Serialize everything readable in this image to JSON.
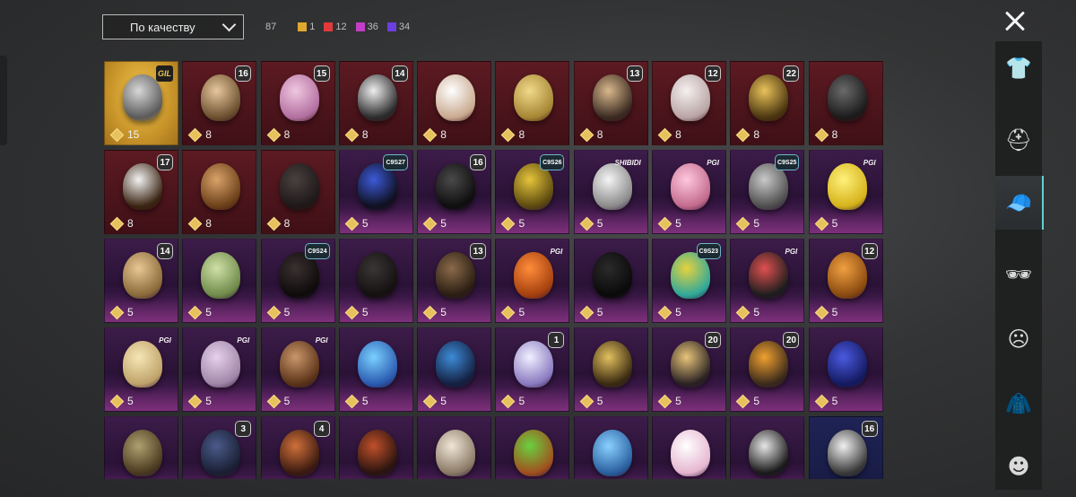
{
  "filter": {
    "selected": "По качеству"
  },
  "counts": {
    "total": "87",
    "groups": [
      {
        "value": "1",
        "color": "#e0a82e"
      },
      {
        "value": "12",
        "color": "#e03a3a"
      },
      {
        "value": "36",
        "color": "#c23ec7"
      },
      {
        "value": "34",
        "color": "#6b3fe0"
      }
    ]
  },
  "colors": {
    "accent": "#5fd0d4",
    "gold": "#e7c15b",
    "red_tier": "#5c1a22",
    "purple_tier": "#3c1c49"
  },
  "sidebar": {
    "categories": [
      {
        "icon": "outfit-icon",
        "glyph": "👕",
        "active": false
      },
      {
        "icon": "helmet-icon",
        "glyph": "⛑",
        "active": false
      },
      {
        "icon": "cap-icon",
        "glyph": "🧢",
        "active": true
      },
      {
        "icon": "goggles-icon",
        "glyph": "🕶",
        "active": false
      },
      {
        "icon": "mask-icon",
        "glyph": "☹",
        "active": false
      },
      {
        "icon": "jacket-icon",
        "glyph": "🧥",
        "active": false
      },
      {
        "icon": "face-icon",
        "glyph": "☻",
        "active": false
      }
    ]
  },
  "items": [
    {
      "tier": "gold",
      "cost": "15",
      "badge": "GIL",
      "badge_kind": "gold-logo",
      "c1": "#d8d8d8",
      "c2": "#5a5a5a"
    },
    {
      "tier": "red",
      "cost": "8",
      "badge": "16",
      "badge_kind": "num",
      "c1": "#e7c69b",
      "c2": "#6b5030"
    },
    {
      "tier": "red",
      "cost": "8",
      "badge": "15",
      "badge_kind": "num",
      "c1": "#f0c7e0",
      "c2": "#b26fa0"
    },
    {
      "tier": "red",
      "cost": "8",
      "badge": "14",
      "badge_kind": "num",
      "c1": "#eeeeee",
      "c2": "#2b2b2b"
    },
    {
      "tier": "red",
      "cost": "8",
      "badge": "",
      "badge_kind": "",
      "c1": "#ffffff",
      "c2": "#c9a98f"
    },
    {
      "tier": "red",
      "cost": "8",
      "badge": "",
      "badge_kind": "",
      "c1": "#f0d98a",
      "c2": "#a58634"
    },
    {
      "tier": "red",
      "cost": "8",
      "badge": "13",
      "badge_kind": "num",
      "c1": "#d9b98c",
      "c2": "#3a2a22"
    },
    {
      "tier": "red",
      "cost": "8",
      "badge": "12",
      "badge_kind": "num",
      "c1": "#f5f0f0",
      "c2": "#b9a4a4"
    },
    {
      "tier": "red",
      "cost": "8",
      "badge": "22",
      "badge_kind": "num",
      "c1": "#e9c25a",
      "c2": "#4a3610"
    },
    {
      "tier": "red",
      "cost": "8",
      "badge": "",
      "badge_kind": "",
      "c1": "#6a6a6a",
      "c2": "#1b1b1b"
    },
    {
      "tier": "red",
      "cost": "8",
      "badge": "17",
      "badge_kind": "num",
      "c1": "#f3f3f3",
      "c2": "#3a2412"
    },
    {
      "tier": "red",
      "cost": "8",
      "badge": "",
      "badge_kind": "",
      "c1": "#d9a26a",
      "c2": "#6b4018"
    },
    {
      "tier": "red",
      "cost": "8",
      "badge": "",
      "badge_kind": "",
      "c1": "#4a4040",
      "c2": "#1e1818"
    },
    {
      "tier": "purple",
      "cost": "5",
      "badge": "C9S27",
      "badge_kind": "season",
      "c1": "#3c5ad8",
      "c2": "#0f1020"
    },
    {
      "tier": "purple",
      "cost": "5",
      "badge": "16",
      "badge_kind": "num",
      "c1": "#4a4a4a",
      "c2": "#0e0e0e"
    },
    {
      "tier": "purple",
      "cost": "5",
      "badge": "C9S26",
      "badge_kind": "season",
      "c1": "#e5c43b",
      "c2": "#5c4a10"
    },
    {
      "tier": "purple",
      "cost": "5",
      "badge": "SHIBIDI",
      "badge_kind": "logo",
      "c1": "#f5f5f5",
      "c2": "#8a8a8a"
    },
    {
      "tier": "purple",
      "cost": "5",
      "badge": "PGI",
      "badge_kind": "logo",
      "c1": "#ffc7dd",
      "c2": "#c26b8c"
    },
    {
      "tier": "purple",
      "cost": "5",
      "badge": "C9S25",
      "badge_kind": "season",
      "c1": "#c9c9c9",
      "c2": "#4e4e4e"
    },
    {
      "tier": "purple",
      "cost": "5",
      "badge": "PGI",
      "badge_kind": "logo",
      "c1": "#fff17a",
      "c2": "#d5b21a"
    },
    {
      "tier": "purple",
      "cost": "5",
      "badge": "14",
      "badge_kind": "num",
      "c1": "#e8c794",
      "c2": "#8a6a3a"
    },
    {
      "tier": "purple",
      "cost": "5",
      "badge": "",
      "badge_kind": "",
      "c1": "#cfe0a6",
      "c2": "#6f8a4a"
    },
    {
      "tier": "purple",
      "cost": "5",
      "badge": "C9S24",
      "badge_kind": "season",
      "c1": "#3a3030",
      "c2": "#0e0b0b"
    },
    {
      "tier": "purple",
      "cost": "5",
      "badge": "",
      "badge_kind": "",
      "c1": "#3b3636",
      "c2": "#141010"
    },
    {
      "tier": "purple",
      "cost": "5",
      "badge": "13",
      "badge_kind": "num",
      "c1": "#8a6a4a",
      "c2": "#2a1d12"
    },
    {
      "tier": "purple",
      "cost": "5",
      "badge": "PGI",
      "badge_kind": "logo",
      "c1": "#ff8c3a",
      "c2": "#a4400e"
    },
    {
      "tier": "purple",
      "cost": "5",
      "badge": "",
      "badge_kind": "",
      "c1": "#2a2a2a",
      "c2": "#0a0a0a"
    },
    {
      "tier": "purple",
      "cost": "5",
      "badge": "C9S23",
      "badge_kind": "season",
      "c1": "#e6d23e",
      "c2": "#2fa89a"
    },
    {
      "tier": "purple",
      "cost": "5",
      "badge": "PGI",
      "badge_kind": "logo",
      "c1": "#e05050",
      "c2": "#1d1d1d"
    },
    {
      "tier": "purple",
      "cost": "5",
      "badge": "12",
      "badge_kind": "num",
      "c1": "#f0a040",
      "c2": "#8a4a10"
    },
    {
      "tier": "purple",
      "cost": "5",
      "badge": "PGI",
      "badge_kind": "logo",
      "c1": "#f5e6b5",
      "c2": "#bfa26a"
    },
    {
      "tier": "purple",
      "cost": "5",
      "badge": "PGI",
      "badge_kind": "logo",
      "c1": "#e6d0ec",
      "c2": "#9f86a8"
    },
    {
      "tier": "purple",
      "cost": "5",
      "badge": "PGI",
      "badge_kind": "logo",
      "c1": "#c9966a",
      "c2": "#5a3318"
    },
    {
      "tier": "purple",
      "cost": "5",
      "badge": "",
      "badge_kind": "",
      "c1": "#7ad0ff",
      "c2": "#2a5ab0"
    },
    {
      "tier": "purple",
      "cost": "5",
      "badge": "",
      "badge_kind": "",
      "c1": "#3d8bd8",
      "c2": "#142040"
    },
    {
      "tier": "purple",
      "cost": "5",
      "badge": "1",
      "badge_kind": "num",
      "c1": "#f0f0ff",
      "c2": "#8a7ac0"
    },
    {
      "tier": "purple",
      "cost": "5",
      "badge": "",
      "badge_kind": "",
      "c1": "#e2c060",
      "c2": "#3a2a10"
    },
    {
      "tier": "purple",
      "cost": "5",
      "badge": "20",
      "badge_kind": "num",
      "c1": "#e8c47a",
      "c2": "#2a2222"
    },
    {
      "tier": "purple",
      "cost": "5",
      "badge": "20",
      "badge_kind": "num",
      "c1": "#f0a030",
      "c2": "#3a2a1a"
    },
    {
      "tier": "purple",
      "cost": "5",
      "badge": "",
      "badge_kind": "",
      "c1": "#4a5ae0",
      "c2": "#141a60"
    },
    {
      "tier": "purple",
      "cost": "",
      "badge": "",
      "badge_kind": "",
      "c1": "#b0a070",
      "c2": "#4a3a20"
    },
    {
      "tier": "purple",
      "cost": "",
      "badge": "3",
      "badge_kind": "num",
      "c1": "#4a5a8a",
      "c2": "#1a1f33"
    },
    {
      "tier": "purple",
      "cost": "",
      "badge": "4",
      "badge_kind": "num",
      "c1": "#d0703a",
      "c2": "#3a1a10"
    },
    {
      "tier": "purple",
      "cost": "",
      "badge": "",
      "badge_kind": "",
      "c1": "#c0502a",
      "c2": "#2a1410"
    },
    {
      "tier": "purple",
      "cost": "",
      "badge": "",
      "badge_kind": "",
      "c1": "#f0e6d6",
      "c2": "#8a7a66"
    },
    {
      "tier": "purple",
      "cost": "",
      "badge": "",
      "badge_kind": "",
      "c1": "#6ad040",
      "c2": "#a0501e"
    },
    {
      "tier": "purple",
      "cost": "",
      "badge": "",
      "badge_kind": "",
      "c1": "#8ad0ff",
      "c2": "#2a60a0"
    },
    {
      "tier": "purple",
      "cost": "",
      "badge": "",
      "badge_kind": "",
      "c1": "#ffffff",
      "c2": "#e6b6d0"
    },
    {
      "tier": "purple",
      "cost": "",
      "badge": "",
      "badge_kind": "",
      "c1": "#e6e6e6",
      "c2": "#1a1a1a"
    },
    {
      "tier": "blue",
      "cost": "",
      "badge": "16",
      "badge_kind": "num",
      "c1": "#f0f0f0",
      "c2": "#3a3a3a"
    }
  ]
}
